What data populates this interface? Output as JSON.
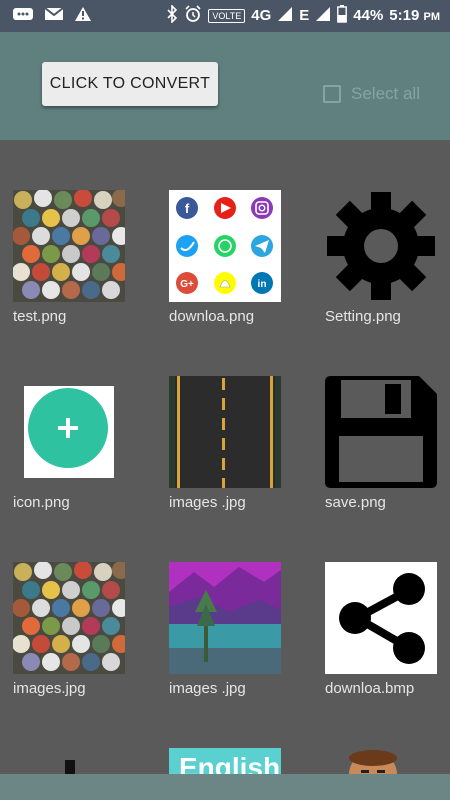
{
  "status_bar": {
    "battery": "44%",
    "time": "5:19",
    "ampm": "PM",
    "network": "4G",
    "volte": "VOLTE",
    "e_label": "E"
  },
  "toolbar": {
    "convert_label": "CLICK TO CONVERT",
    "select_all_label": "Select all"
  },
  "files": [
    {
      "name": "test.png",
      "icon": "marbles-thumbnail"
    },
    {
      "name": "downloa.png",
      "icon": "social-icons-thumbnail"
    },
    {
      "name": "Setting.png",
      "icon": "gear-icon"
    },
    {
      "name": "icon.png",
      "icon": "add-fab-icon"
    },
    {
      "name": "images .jpg",
      "icon": "road-thumbnail"
    },
    {
      "name": "save.png",
      "icon": "floppy-save-icon"
    },
    {
      "name": "images.jpg",
      "icon": "marbles-thumbnail"
    },
    {
      "name": "images .jpg",
      "icon": "purple-landscape-thumbnail"
    },
    {
      "name": "downloa.bmp",
      "icon": "share-icon"
    }
  ],
  "partial_row": {
    "english_text": "English"
  }
}
